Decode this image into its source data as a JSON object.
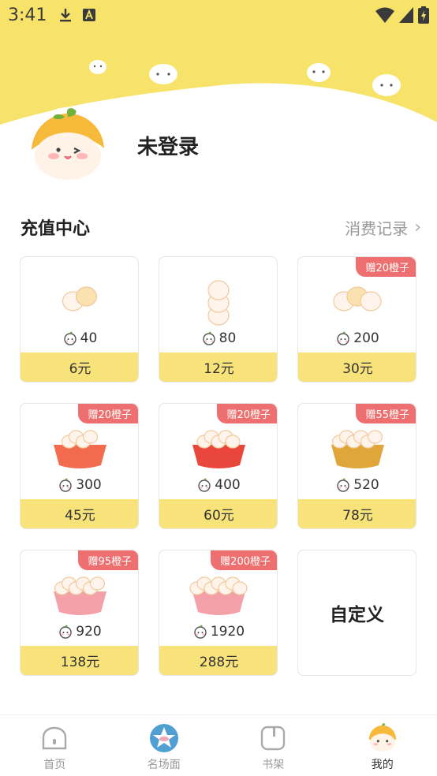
{
  "status_bar": {
    "time": "3:41",
    "icons": [
      "download-icon",
      "text-a-icon",
      "wifi-icon",
      "signal-icon",
      "battery-charging-icon"
    ]
  },
  "profile": {
    "username": "未登录",
    "avatar_icon": "orange-mascot-avatar-icon"
  },
  "recharge": {
    "title": "充值中心",
    "history_label": "消费记录",
    "packages": [
      {
        "coins": "40",
        "price": "6元",
        "badge": ""
      },
      {
        "coins": "80",
        "price": "12元",
        "badge": ""
      },
      {
        "coins": "200",
        "price": "30元",
        "badge": "赠20橙子"
      },
      {
        "coins": "300",
        "price": "45元",
        "badge": "赠20橙子"
      },
      {
        "coins": "400",
        "price": "60元",
        "badge": "赠20橙子"
      },
      {
        "coins": "520",
        "price": "78元",
        "badge": "赠55橙子"
      },
      {
        "coins": "920",
        "price": "138元",
        "badge": "赠95橙子"
      },
      {
        "coins": "1920",
        "price": "288元",
        "badge": "赠200橙子"
      }
    ],
    "custom_label": "自定义"
  },
  "nav": {
    "items": [
      {
        "label": "首页",
        "icon": "home-icon",
        "active": false
      },
      {
        "label": "名场面",
        "icon": "star-badge-icon",
        "active": false
      },
      {
        "label": "书架",
        "icon": "bookshelf-icon",
        "active": false
      },
      {
        "label": "我的",
        "icon": "mascot-profile-icon",
        "active": true
      }
    ]
  },
  "colors": {
    "header_yellow": "#f8e36a",
    "price_bar": "#f8e27a",
    "badge_red": "#ee6f6f",
    "text_grey": "#999999"
  }
}
